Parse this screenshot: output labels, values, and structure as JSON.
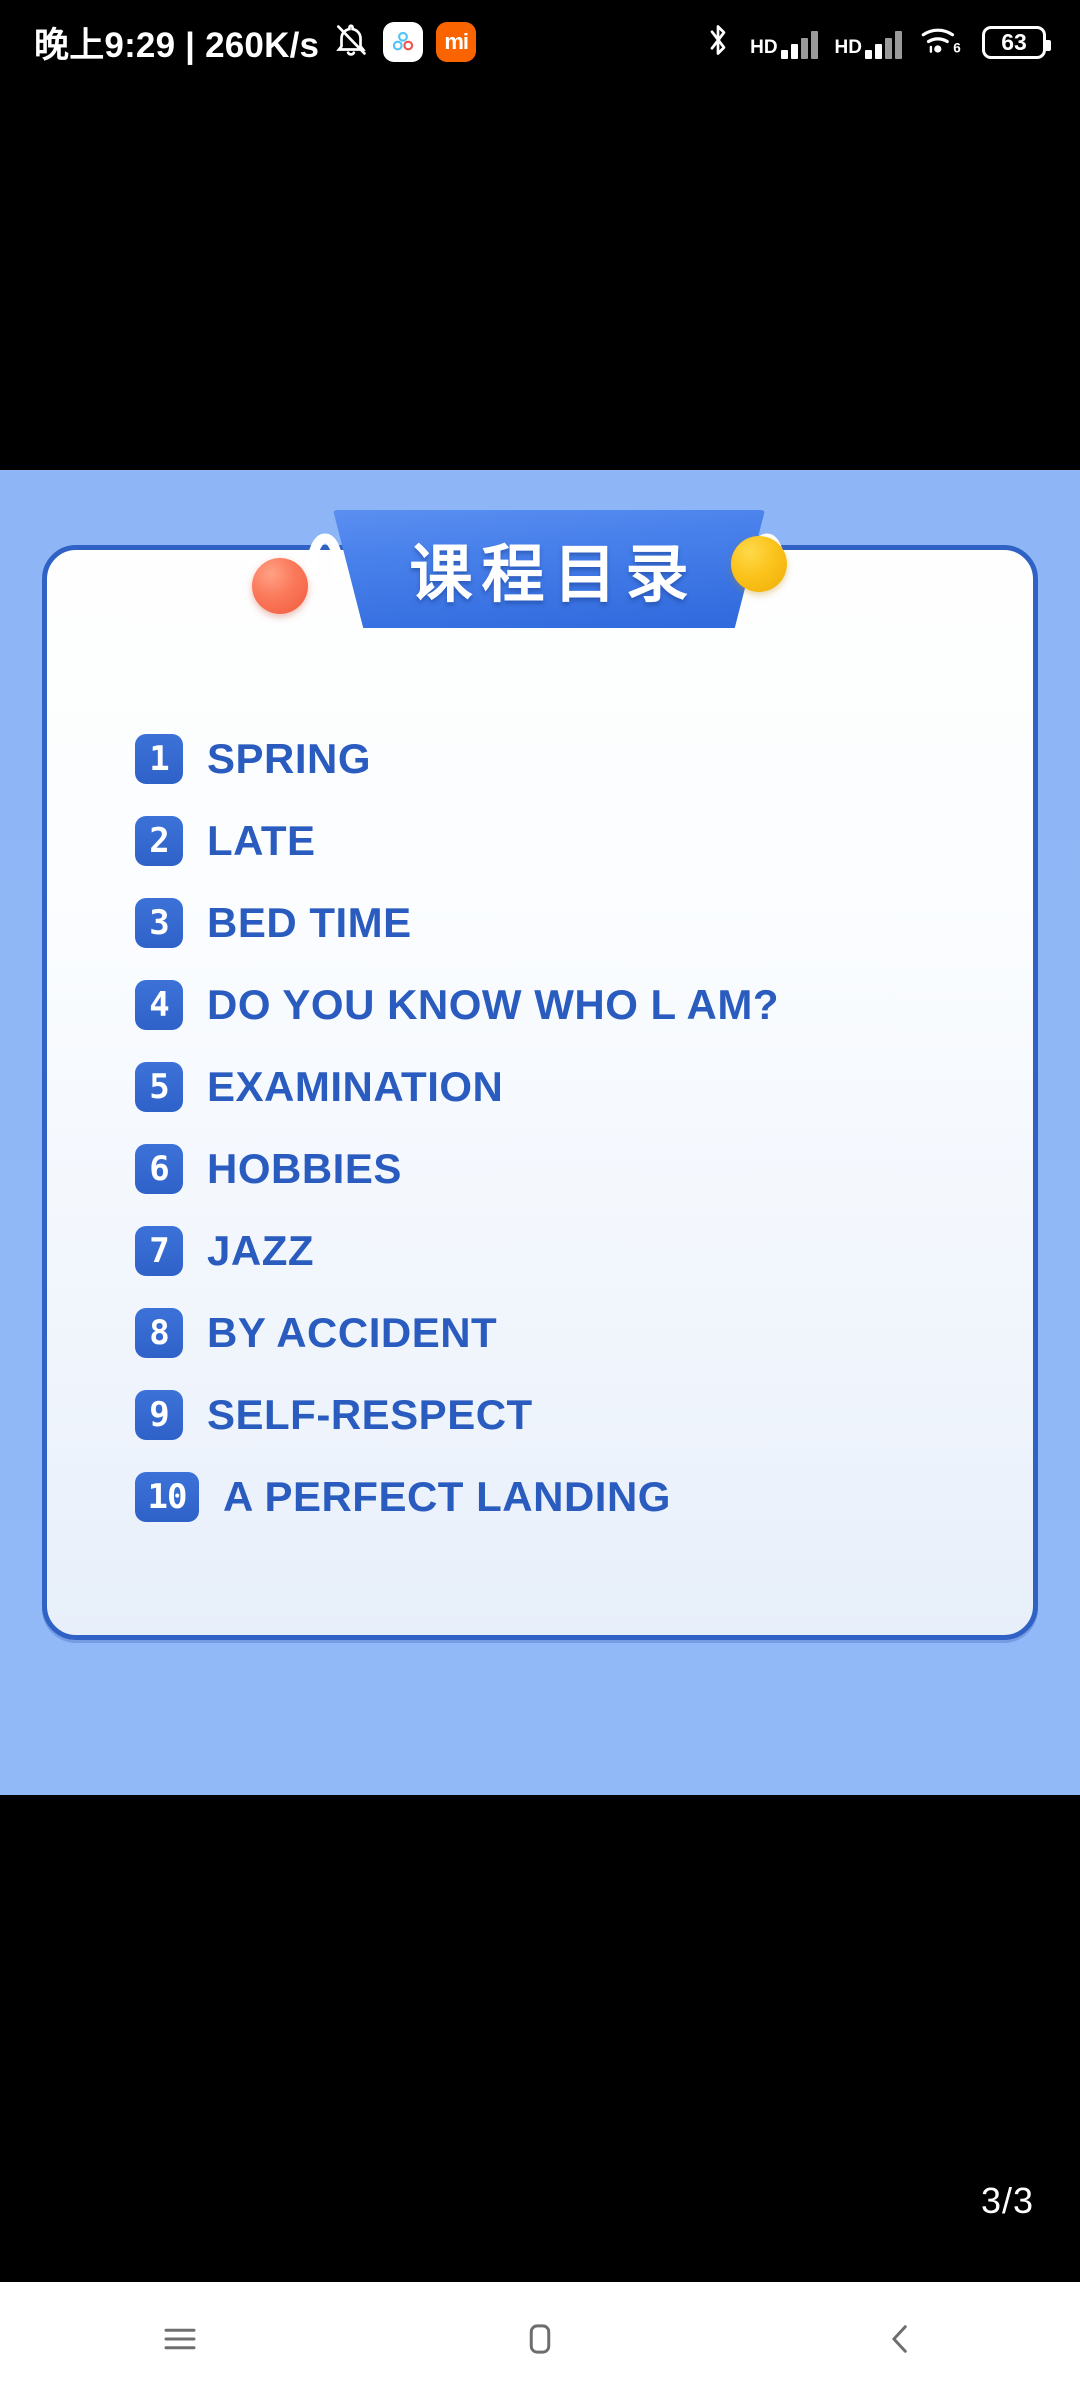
{
  "status_bar": {
    "clock": "晚上9:29 | 260K/s",
    "icons": [
      {
        "name": "silent-bell-icon"
      },
      {
        "name": "mint-app-icon"
      },
      {
        "name": "mi-app-icon",
        "label": "mi"
      },
      {
        "name": "bluetooth-icon"
      },
      {
        "name": "signal-sim1-icon",
        "label": "HD"
      },
      {
        "name": "signal-sim2-icon",
        "label": "HD"
      },
      {
        "name": "wifi6-icon",
        "label": "6"
      },
      {
        "name": "battery-icon"
      }
    ],
    "battery_level": "63",
    "hd_label_1": "HD",
    "hd_label_2": "HD",
    "wifi_generation": "6"
  },
  "slide": {
    "banner_title": "课程目录",
    "colors": {
      "background": "#8FB7F6",
      "card_border": "#2F62C4",
      "banner_start": "#5B8FF0",
      "banner_end": "#2F68DC",
      "badge": "#2F62C8",
      "label_text": "#2A5CC0",
      "dot_red": "#F15A3C",
      "dot_yellow": "#FBC31C"
    },
    "items": [
      {
        "number": "1",
        "label": "SPRING"
      },
      {
        "number": "2",
        "label": "LATE"
      },
      {
        "number": "3",
        "label": "BED TIME"
      },
      {
        "number": "4",
        "label": "DO YOU KNOW WHO L AM?"
      },
      {
        "number": "5",
        "label": "EXAMINATION"
      },
      {
        "number": "6",
        "label": "HOBBIES"
      },
      {
        "number": "7",
        "label": "JAZZ"
      },
      {
        "number": "8",
        "label": "BY ACCIDENT"
      },
      {
        "number": "9",
        "label": "SELF-RESPECT"
      },
      {
        "number": "10",
        "label": "A PERFECT LANDING"
      }
    ]
  },
  "viewer": {
    "page_indicator": "3/3"
  },
  "navbar": {
    "recents_label": "recents-icon",
    "home_label": "home-icon",
    "back_label": "back-icon"
  }
}
